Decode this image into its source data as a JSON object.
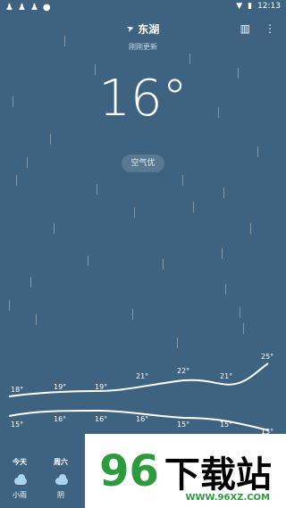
{
  "status": {
    "time": "12:13",
    "left_icons": [
      "qq-icon",
      "qq-icon",
      "qq-icon",
      "chat-icon"
    ],
    "right_icons": [
      "wifi-icon",
      "battery-icon"
    ]
  },
  "header": {
    "location": "东湖",
    "updated": "刚刚更新"
  },
  "current": {
    "temperature": "16°",
    "aqi": "空气优"
  },
  "forecast": {
    "days": [
      {
        "name": "今天",
        "weather": "小雨"
      },
      {
        "name": "周六",
        "weather": "阴"
      }
    ],
    "high_temps": [
      "18°",
      "19°",
      "19°",
      "21°",
      "22°",
      "21°",
      "25°"
    ],
    "low_temps": [
      "15°",
      "16°",
      "16°",
      "16°",
      "15°",
      "15°",
      "13°"
    ]
  },
  "watermark": {
    "brand_num": "96",
    "brand_text": "下载站",
    "url": "WWW.96XZ.COM"
  },
  "colors": {
    "background": "#3e6381",
    "cloud": "#a9d3f3",
    "brand": "#2c9a3d"
  }
}
